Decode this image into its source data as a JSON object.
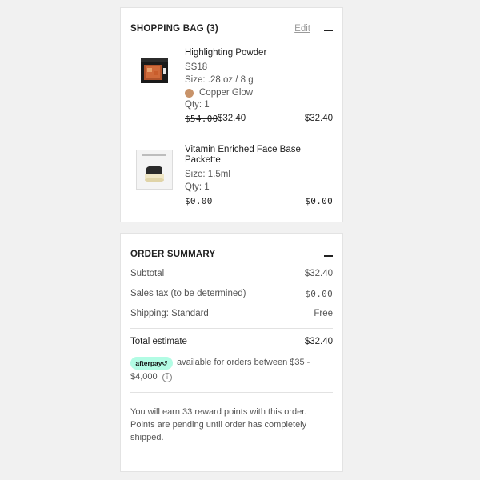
{
  "bag": {
    "title": "SHOPPING BAG (3)",
    "edit_label": "Edit",
    "items": [
      {
        "name": "Highlighting Powder",
        "code": "SS18",
        "size": "Size: .28 oz / 8 g",
        "shade": "Copper Glow",
        "qty": "Qty: 1",
        "original_price": "$54.00",
        "sale_price": "$32.40",
        "total": "$32.40"
      },
      {
        "name_line1": "Vitamin Enriched Face Base",
        "name_line2": "Packette",
        "size": "Size: 1.5ml",
        "qty": "Qty: 1",
        "price": "$0.00",
        "total": "$0.00",
        "brand_print": "BOBBI BROWN"
      }
    ]
  },
  "summary": {
    "title": "ORDER SUMMARY",
    "subtotal_label": "Subtotal",
    "subtotal_value": "$32.40",
    "tax_label": "Sales tax (to be determined)",
    "tax_value": "$0.00",
    "shipping_label": "Shipping: Standard",
    "shipping_value": "Free",
    "total_label": "Total estimate",
    "total_value": "$32.40",
    "afterpay_badge": "afterpay↺",
    "afterpay_line1": "available for orders between $35 -",
    "afterpay_line2": "$4,000",
    "info_icon": "i",
    "rewards_line1": "You will earn 33 reward points with this order.",
    "rewards_line2": "Points are pending until order has completely",
    "rewards_line3": "shipped."
  },
  "colors": {
    "background": "#f1f1f1",
    "panel": "#ffffff",
    "afterpay_mint": "#b2fce4",
    "shade_swatch": "#c8936a"
  }
}
